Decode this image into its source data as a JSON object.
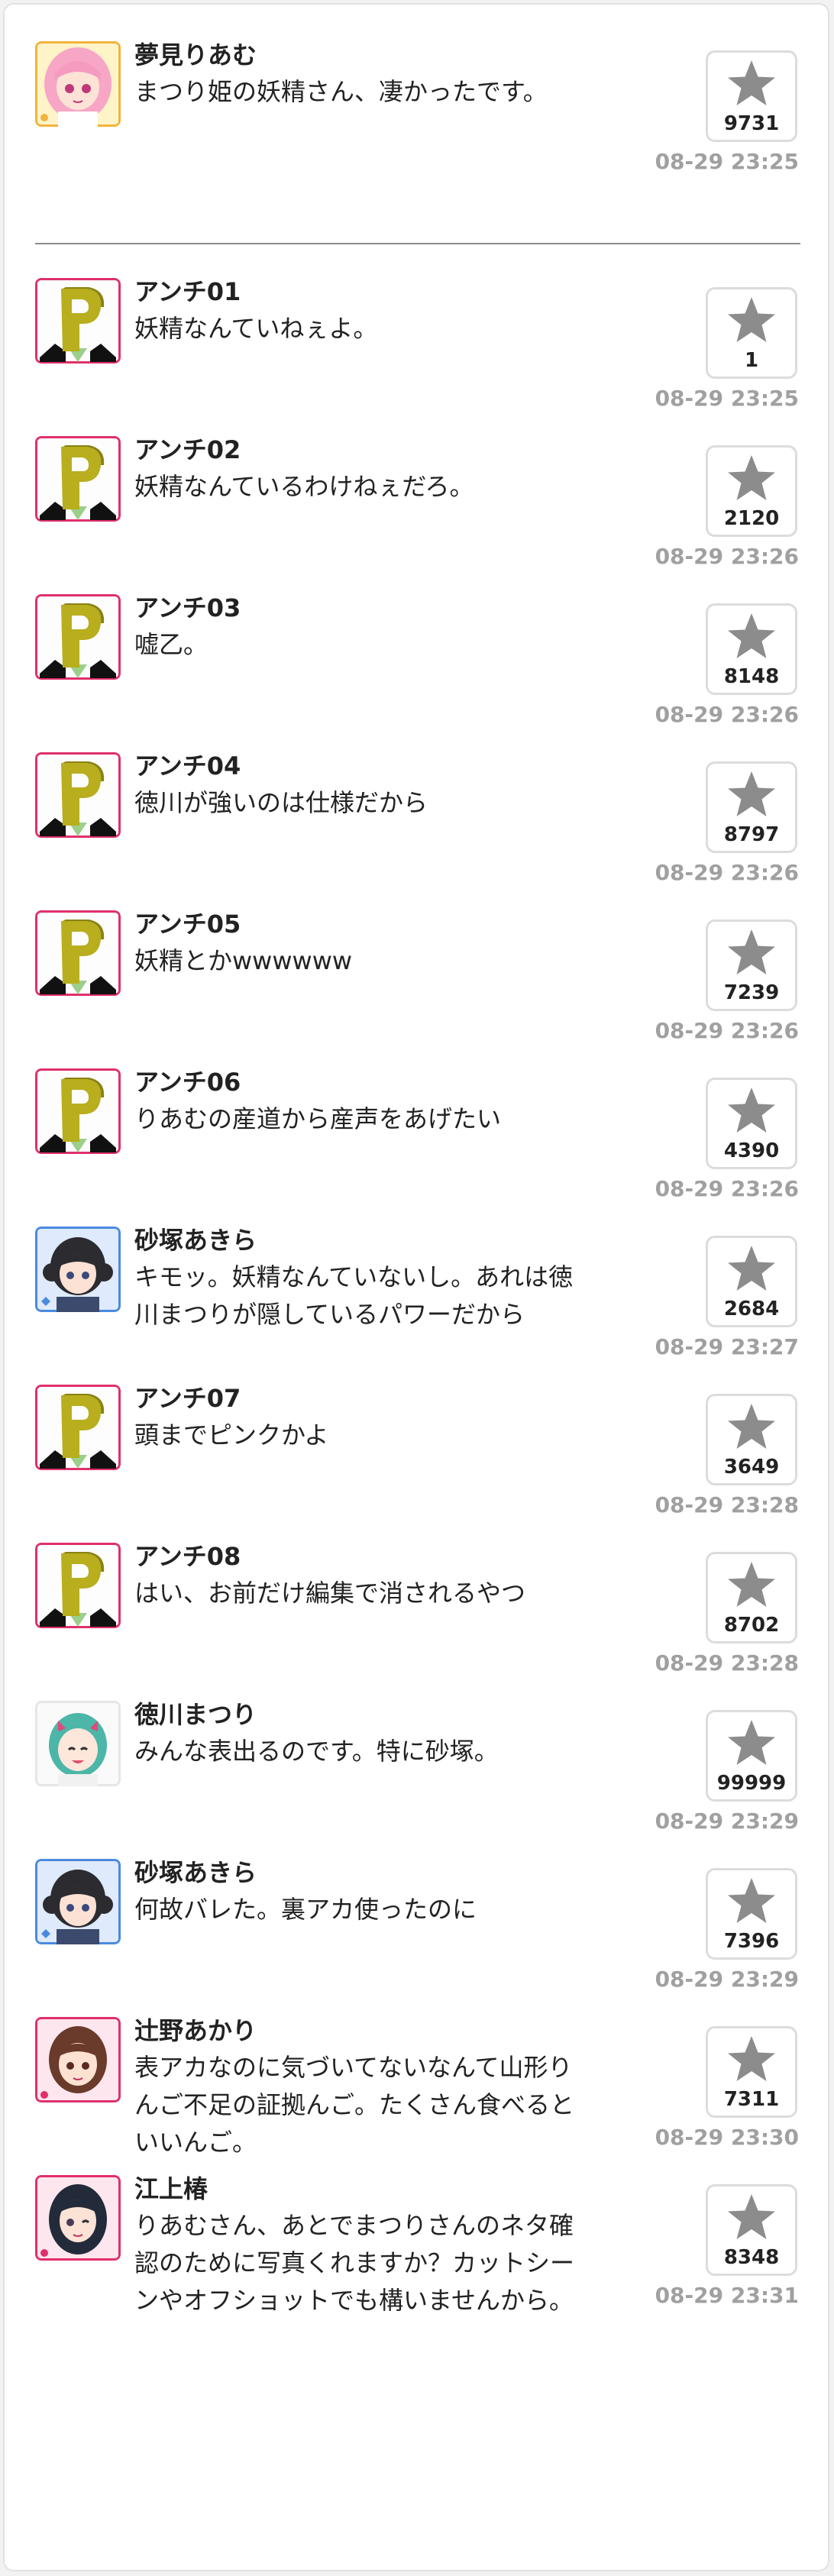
{
  "posts": [
    {
      "name": "夢見りあむ",
      "message": "まつり姫の妖精さん、凄かったです。",
      "stars": "9731",
      "time": "08-29 23:25",
      "avatar": "riamu-avatar"
    },
    {
      "name": "アンチ01",
      "message": "妖精なんていねぇよ。",
      "stars": "1",
      "time": "08-29 23:25",
      "avatar": "p-avatar"
    },
    {
      "name": "アンチ02",
      "message": "妖精なんているわけねぇだろ。",
      "stars": "2120",
      "time": "08-29 23:26",
      "avatar": "p-avatar"
    },
    {
      "name": "アンチ03",
      "message": "嘘乙。",
      "stars": "8148",
      "time": "08-29 23:26",
      "avatar": "p-avatar"
    },
    {
      "name": "アンチ04",
      "message": "徳川が強いのは仕様だから",
      "stars": "8797",
      "time": "08-29 23:26",
      "avatar": "p-avatar"
    },
    {
      "name": "アンチ05",
      "message": "妖精とかwwwwww",
      "stars": "7239",
      "time": "08-29 23:26",
      "avatar": "p-avatar"
    },
    {
      "name": "アンチ06",
      "message": "りあむの産道から産声をあげたい",
      "stars": "4390",
      "time": "08-29 23:26",
      "avatar": "p-avatar"
    },
    {
      "name": "砂塚あきら",
      "message": "キモッ。妖精なんていないし。あれは徳川まつりが隠しているパワーだから",
      "stars": "2684",
      "time": "08-29 23:27",
      "avatar": "akira-avatar"
    },
    {
      "name": "アンチ07",
      "message": "頭までピンクかよ",
      "stars": "3649",
      "time": "08-29 23:28",
      "avatar": "p-avatar"
    },
    {
      "name": "アンチ08",
      "message": "はい、お前だけ編集で消されるやつ",
      "stars": "8702",
      "time": "08-29 23:28",
      "avatar": "p-avatar"
    },
    {
      "name": "徳川まつり",
      "message": "みんな表出るのです。特に砂塚。",
      "stars": "99999",
      "time": "08-29 23:29",
      "avatar": "matsuri-avatar"
    },
    {
      "name": "砂塚あきら",
      "message": "何故バレた。裏アカ使ったのに",
      "stars": "7396",
      "time": "08-29 23:29",
      "avatar": "akira-avatar"
    },
    {
      "name": "辻野あかり",
      "message": "表アカなのに気づいてないなんて山形りんご不足の証拠んご。たくさん食べるといいんご。",
      "stars": "7311",
      "time": "08-29 23:30",
      "avatar": "akari-avatar"
    },
    {
      "name": "江上椿",
      "message": "りあむさん、あとでまつりさんのネタ確認のために写真くれますか？カットシーンやオフショットでも構いませんから。",
      "stars": "8348",
      "time": "08-29 23:31",
      "avatar": "tsubaki-avatar"
    }
  ],
  "colors": {
    "timestamp": "#a0a0a0",
    "star": "#8c8c8c",
    "p_logo": "#b8ae1e",
    "p_border": "#e0306a",
    "riamu_border": "#f2b43c",
    "akira_border": "#4a8ae0",
    "akari_border": "#e0306a"
  },
  "icons": {
    "star": "star-icon"
  }
}
